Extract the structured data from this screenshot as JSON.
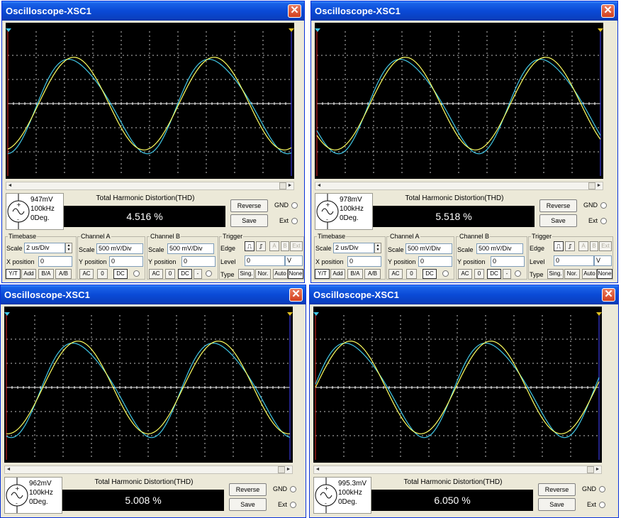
{
  "window_title": "Oscilloscope-XSC1",
  "close_glyph": "✕",
  "thd_label": "Total Harmonic Distortion(THD)",
  "buttons": {
    "reverse": "Reverse",
    "save": "Save"
  },
  "radios": {
    "gnd": "GND",
    "ext": "Ext"
  },
  "colors": {
    "trace_a": "#ffff60",
    "trace_b": "#40c8e8",
    "cursor_left": "#e02020",
    "cursor_right": "#4040ff",
    "grid": "#ffffff"
  },
  "scopes": [
    {
      "generator": {
        "amplitude": "947mV",
        "frequency": "100kHz",
        "phase": "0Deg."
      },
      "thd_value": "4.516 %"
    },
    {
      "generator": {
        "amplitude": "978mV",
        "frequency": "100kHz",
        "phase": "0Deg."
      },
      "thd_value": "5.518 %"
    },
    {
      "generator": {
        "amplitude": "962mV",
        "frequency": "100kHz",
        "phase": "0Deg."
      },
      "thd_value": "5.008 %"
    },
    {
      "generator": {
        "amplitude": "995.3mV",
        "frequency": "100kHz",
        "phase": "0Deg."
      },
      "thd_value": "6.050 %"
    }
  ],
  "controls": {
    "timebase": {
      "title": "Timebase",
      "scale_label": "Scale",
      "scale_value": "2 us/Div",
      "xpos_label": "X position",
      "xpos_value": "0",
      "modes": [
        "Y/T",
        "Add",
        "B/A",
        "A/B"
      ]
    },
    "channel_a": {
      "title": "Channel A",
      "scale_label": "Scale",
      "scale_value": "500 mV/Div",
      "ypos_label": "Y position",
      "ypos_value": "0",
      "coupling": [
        "AC",
        "0",
        "DC"
      ]
    },
    "channel_b": {
      "title": "Channel B",
      "scale_label": "Scale",
      "scale_value": "500 mV/Div",
      "ypos_label": "Y position",
      "ypos_value": "0",
      "coupling": [
        "AC",
        "0",
        "DC",
        "-"
      ]
    },
    "trigger": {
      "title": "Trigger",
      "edge_label": "Edge",
      "edge_sources": [
        "A",
        "B",
        "Ext"
      ],
      "level_label": "Level",
      "level_value": "0",
      "level_unit": "V",
      "type_label": "Type",
      "types": [
        "Sing.",
        "Nor.",
        "Auto",
        "None"
      ]
    }
  }
}
